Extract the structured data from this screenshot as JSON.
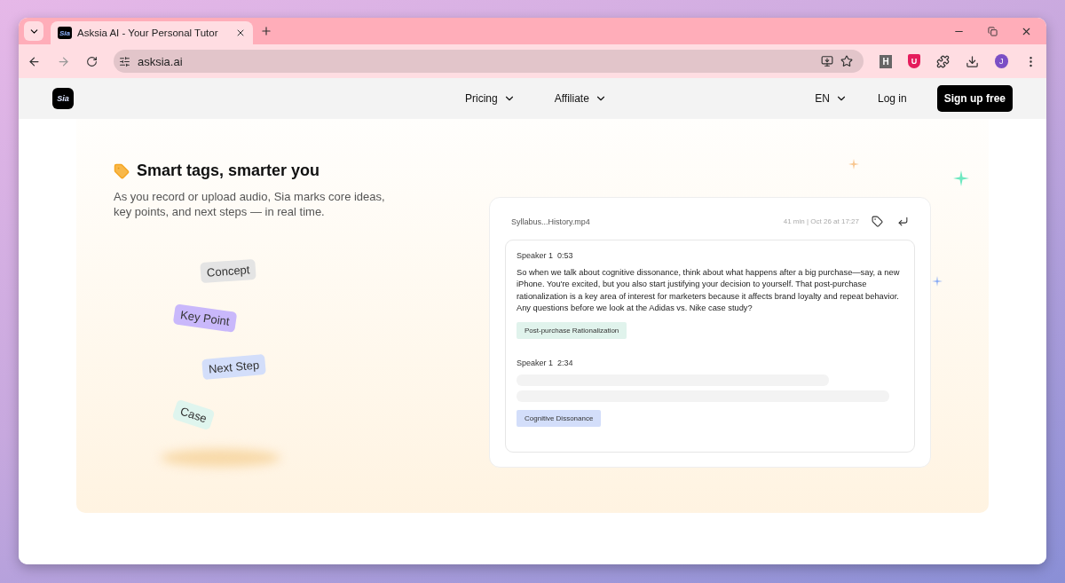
{
  "browser": {
    "tab_title": "Asksia AI - Your Personal Tutor",
    "tab_logo": "Sia",
    "address": "asksia.ai",
    "extension_letter": "H",
    "extension_badge": "U",
    "profile_initial": "J"
  },
  "nav": {
    "logo": "Sia",
    "menus": [
      {
        "label": "Pricing"
      },
      {
        "label": "Affiliate"
      }
    ],
    "language": "EN",
    "login": "Log in",
    "signup": "Sign up free"
  },
  "hero": {
    "title": "Smart tags, smarter you",
    "subtitle": "As you record or upload audio, Sia marks core ideas, key points, and next steps — in real time.",
    "tags": [
      {
        "label": "Concept",
        "color": "#e4e4e4"
      },
      {
        "label": "Key Point",
        "color": "#c9b8fb"
      },
      {
        "label": "Next Step",
        "color": "#d3defa"
      },
      {
        "label": "Case",
        "color": "#dff5ee"
      }
    ]
  },
  "transcript": {
    "file": "Syllabus...History.mp4",
    "meta": "41 min | Oct 26 at 17:27",
    "entries": [
      {
        "speaker": "Speaker 1",
        "time": "0:53",
        "text": "So when we talk about cognitive dissonance, think about what happens after a big purchase—say, a new iPhone. You're excited, but you also start justifying your decision to yourself. That post-purchase rationalization is a key area of interest for marketers because it affects brand loyalty and repeat behavior. Any questions before we look at the Adidas vs. Nike case study?",
        "tag": "Post-purchase Rationalization",
        "color": "#e0f3ec"
      },
      {
        "speaker": "Speaker 1",
        "time": "2:34",
        "tag": "Cognitive Dissonance",
        "color": "#d3defa"
      }
    ]
  }
}
